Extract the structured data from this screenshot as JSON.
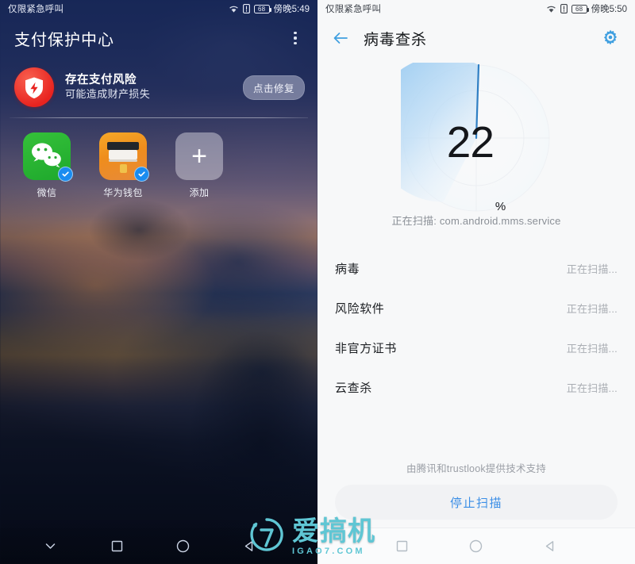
{
  "left": {
    "statusbar": {
      "carrier": "仅限紧急呼叫",
      "wifi_icon": "wifi-icon",
      "sim_icon": "sim-card-icon",
      "battery_level": "68",
      "time": "傍晚5:49"
    },
    "header": {
      "title": "支付保护中心",
      "menu_icon": "more-vertical-icon"
    },
    "risk_card": {
      "shield_icon": "shield-alert-icon",
      "title": "存在支付风险",
      "subtitle": "可能造成财产损失",
      "action_label": "点击修复"
    },
    "apps": [
      {
        "label": "微信",
        "icon": "wechat-icon",
        "verified": true
      },
      {
        "label": "华为钱包",
        "icon": "huawei-wallet-icon",
        "verified": true
      },
      {
        "label": "添加",
        "icon": "plus-icon",
        "verified": false
      }
    ],
    "navbar": [
      {
        "icon": "chevron-down-icon",
        "name": "hide-navbar-button"
      },
      {
        "icon": "square-icon",
        "name": "recents-button"
      },
      {
        "icon": "circle-icon",
        "name": "home-button"
      },
      {
        "icon": "triangle-left-icon",
        "name": "back-button"
      }
    ]
  },
  "right": {
    "statusbar": {
      "carrier": "仅限紧急呼叫",
      "wifi_icon": "wifi-icon",
      "sim_icon": "sim-card-icon",
      "battery_level": "68",
      "time": "傍晚5:50"
    },
    "header": {
      "back_icon": "arrow-left-icon",
      "title": "病毒查杀",
      "settings_icon": "gear-icon"
    },
    "scan": {
      "percent": "22",
      "percent_symbol": "%",
      "progress_value": 22,
      "sweep_degrees": 190,
      "current_target": "正在扫描: com.android.mms.service",
      "accent_color": "#8ec6f0",
      "sweep_edge_color": "#2f7fc4"
    },
    "rows": [
      {
        "label": "病毒",
        "status": "正在扫描..."
      },
      {
        "label": "风险软件",
        "status": "正在扫描..."
      },
      {
        "label": "非官方证书",
        "status": "正在扫描..."
      },
      {
        "label": "云查杀",
        "status": "正在扫描..."
      }
    ],
    "credit": "由腾讯和trustlook提供技术支持",
    "stop_button": "停止扫描",
    "navbar": [
      {
        "icon": "square-icon",
        "name": "recents-button"
      },
      {
        "icon": "circle-icon",
        "name": "home-button"
      },
      {
        "icon": "triangle-left-icon",
        "name": "back-button"
      }
    ]
  },
  "watermark": {
    "logo_icon": "igao7-logo-icon",
    "cn": "爱搞机",
    "en": "IGAO7.COM",
    "color": "#5fc6d4"
  }
}
